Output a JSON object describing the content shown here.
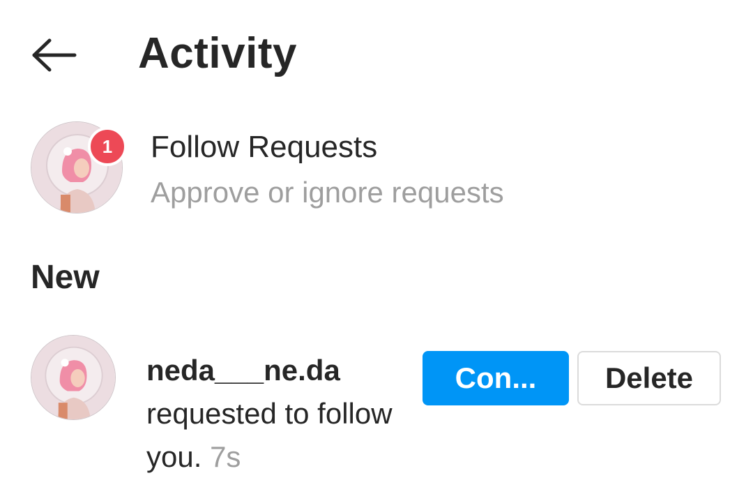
{
  "header": {
    "title": "Activity"
  },
  "follow_requests": {
    "title": "Follow Requests",
    "subtitle": "Approve or ignore requests",
    "badge_count": "1"
  },
  "sections": {
    "new_label": "New"
  },
  "notification": {
    "username": "neda___ne.da",
    "message": "requested to follow you.",
    "time": "7s",
    "confirm_label": "Con...",
    "delete_label": "Delete"
  },
  "colors": {
    "accent_blue": "#0095f6",
    "badge_red": "#ed4956",
    "text_primary": "#262626",
    "text_secondary": "#9e9e9e"
  }
}
